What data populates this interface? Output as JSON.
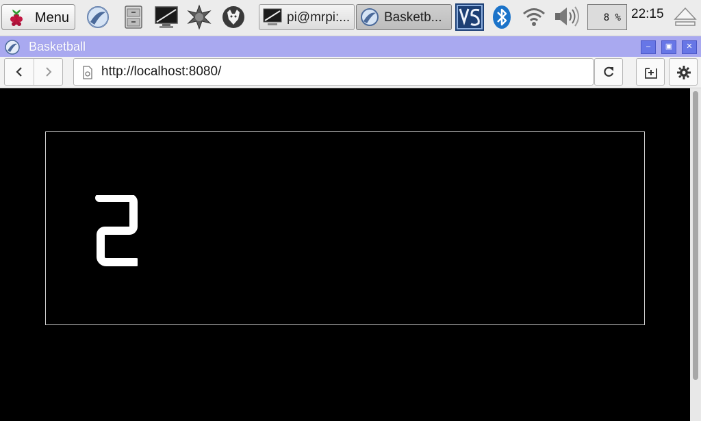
{
  "taskbar": {
    "menu_label": "Menu",
    "launchers": [
      {
        "name": "web-browser-icon"
      },
      {
        "name": "file-manager-icon"
      },
      {
        "name": "terminal-icon"
      },
      {
        "name": "math-kernel-icon"
      },
      {
        "name": "wolfram-icon"
      }
    ],
    "tasks": [
      {
        "name": "task-terminal",
        "label": "pi@mrpi:...",
        "active": false
      },
      {
        "name": "task-basketball",
        "label": "Basketb...",
        "active": true
      }
    ],
    "tray": {
      "cpu_usage": "8 %",
      "clock": "22:15"
    }
  },
  "window": {
    "title": "Basketball",
    "buttons": [
      "minimize",
      "maximize",
      "close"
    ]
  },
  "browser": {
    "url": "http://localhost:8080/"
  },
  "page": {
    "score": "2"
  },
  "colors": {
    "titlebar": "#a9a9f0",
    "page_background": "#000000",
    "score_color": "#ffffff"
  }
}
